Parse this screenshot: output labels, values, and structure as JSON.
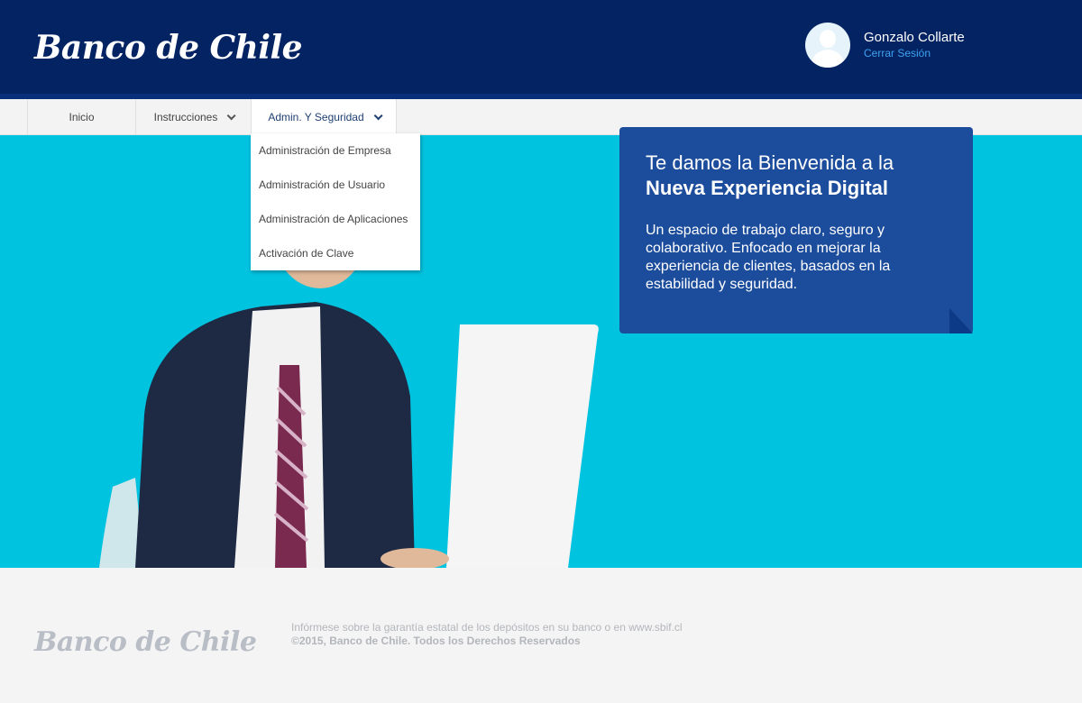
{
  "header": {
    "logo_text": "Banco de Chile",
    "user_name": "Gonzalo Collarte",
    "logout_label": "Cerrar Sesión",
    "avatar_icon": "user-avatar-icon"
  },
  "nav": {
    "items": [
      {
        "label": "Inicio",
        "has_dropdown": false
      },
      {
        "label": "Instrucciones",
        "has_dropdown": true
      },
      {
        "label": "Admin. Y Seguridad",
        "has_dropdown": true,
        "active": true
      }
    ]
  },
  "dropdown": {
    "items": [
      "Administración de Empresa",
      "Administración de Usuario",
      "Administración de Aplicaciones",
      "Activación de Clave"
    ]
  },
  "hero": {
    "title_line1": "Te damos la Bienvenida a la",
    "title_line2": "Nueva Experiencia Digital",
    "body": "Un espacio de trabajo claro, seguro y colaborativo. Enfocado en mejorar la experiencia de clientes, basados en la estabilidad y seguridad."
  },
  "footer": {
    "logo_text": "Banco de Chile",
    "line1": "Infórmese sobre la garantía estatal de los depósitos en su banco o en www.sbif.cl",
    "line2": "©2015, Banco de Chile. Todos los Derechos Reservados"
  },
  "colors": {
    "header_bg": "#042363",
    "hero_bg": "#00c3e0",
    "card_bg": "#1c4c9c",
    "link": "#3da2f0"
  }
}
